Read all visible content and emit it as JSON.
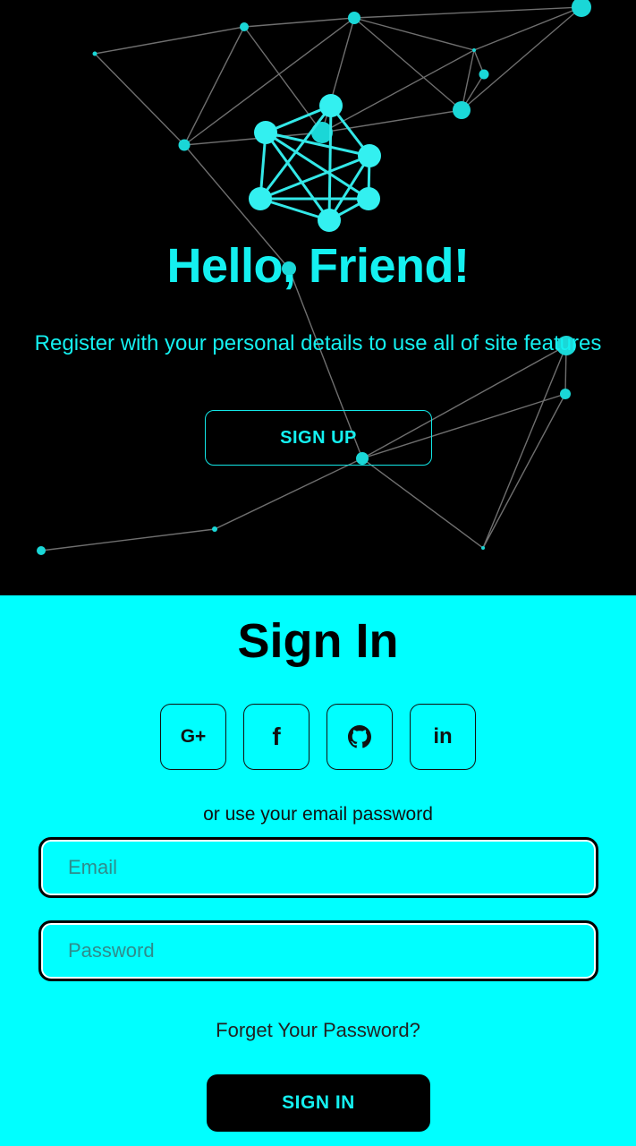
{
  "colors": {
    "accent": "#14f0f0",
    "hero_bg": "#000000",
    "signin_bg": "#00ffff",
    "button_dark": "#000000"
  },
  "hero": {
    "title": "Hello, Friend!",
    "subtitle": "Register with your personal details to use all of site features",
    "signup_label": "SIGN UP"
  },
  "signin": {
    "title": "Sign In",
    "social": [
      {
        "icon": "google-plus-icon",
        "label": "G+"
      },
      {
        "icon": "facebook-icon",
        "label": "f"
      },
      {
        "icon": "github-icon",
        "label": ""
      },
      {
        "icon": "linkedin-icon",
        "label": "in"
      }
    ],
    "or_text": "or use your email password",
    "email_placeholder": "Email",
    "password_placeholder": "Password",
    "forgot_label": "Forget Your Password?",
    "signin_label": "SIGN IN"
  }
}
